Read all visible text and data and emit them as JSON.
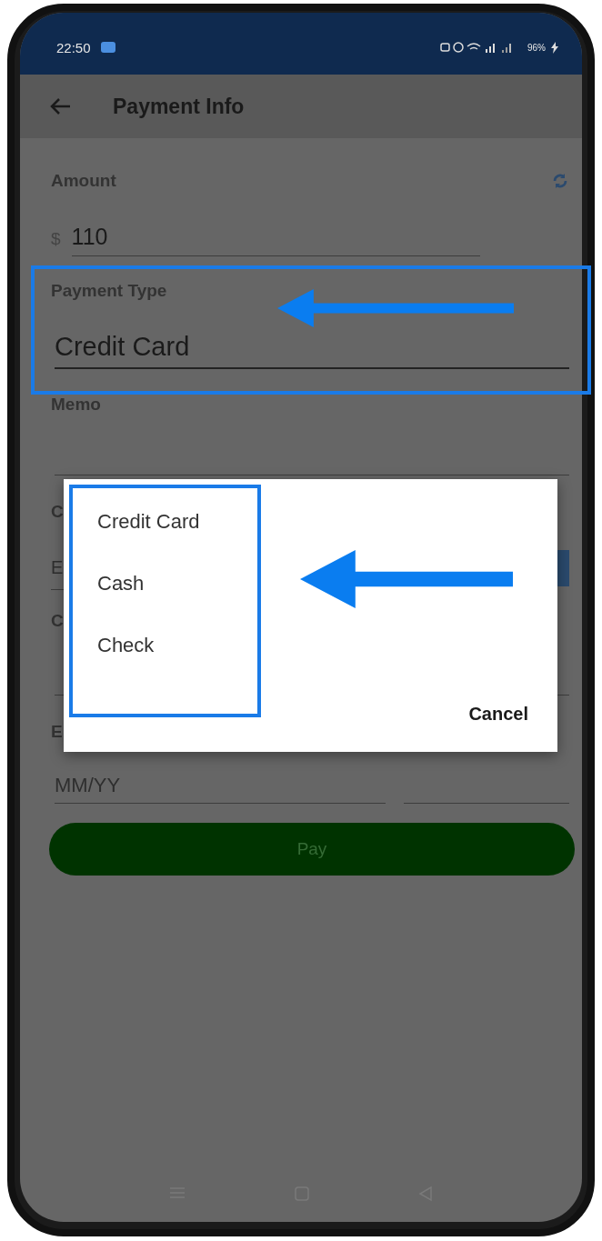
{
  "status_bar": {
    "time": "22:50",
    "battery": "96%"
  },
  "app_bar": {
    "title": "Payment Info"
  },
  "fields": [
    {
      "kind": "amount",
      "label": "Amount",
      "prefix": "$",
      "value": "110"
    },
    {
      "kind": "select",
      "label": "Payment Type",
      "value": "Credit Card"
    },
    {
      "kind": "text",
      "label": "Memo"
    },
    {
      "kind": "button_field",
      "label": "C",
      "placeholder": "E"
    },
    {
      "kind": "text",
      "label": "C"
    },
    {
      "kind": "split",
      "label": "E",
      "placeholder": "MM/YY"
    }
  ],
  "pay_button": "Pay",
  "dialog": {
    "options": [
      {
        "label": "Credit Card"
      },
      {
        "label": "Cash"
      },
      {
        "label": "Check"
      }
    ],
    "cancel": "Cancel"
  }
}
